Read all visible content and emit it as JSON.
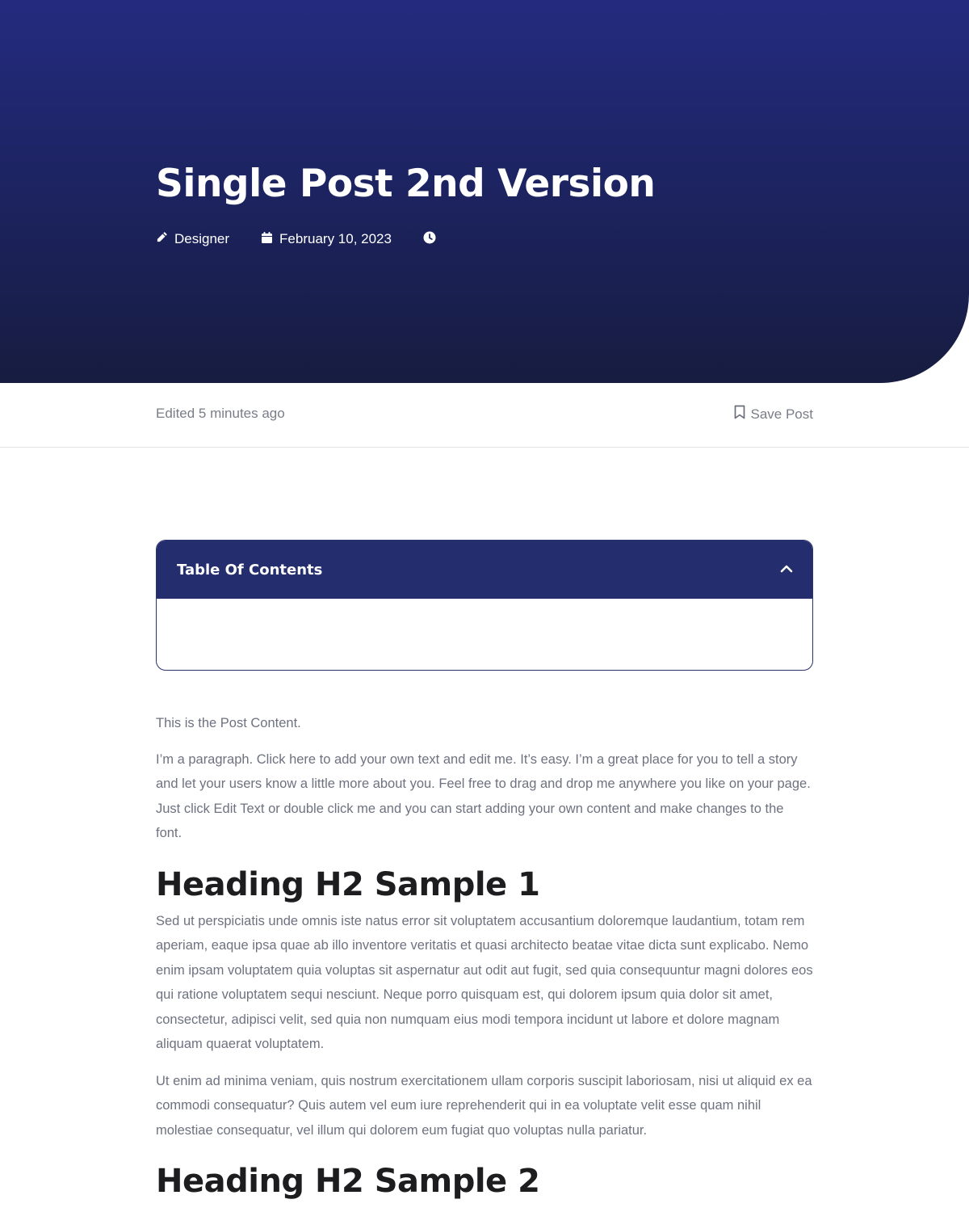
{
  "hero": {
    "title": "Single Post 2nd Version",
    "meta": {
      "author": "Designer",
      "date": "February 10, 2023",
      "reading_time": ""
    }
  },
  "subbar": {
    "edited": "Edited 5 minutes ago",
    "save_label": "Save Post"
  },
  "toc": {
    "title": "Table Of Contents"
  },
  "content": {
    "intro": "This is the Post Content.",
    "paragraph1": "I’m a paragraph. Click here to add your own text and edit me. It’s easy. I’m a great place for you to tell a story and let your users know a little more about you. Feel free to drag and drop me anywhere you like on your page. Just click Edit Text or double click me and you can start adding your own content and make changes to the font.",
    "heading1": "Heading H2 Sample 1",
    "paragraph2": "Sed ut perspiciatis unde omnis iste natus error sit voluptatem accusantium doloremque laudantium, totam rem aperiam, eaque ipsa quae ab illo inventore veritatis et quasi architecto beatae vitae dicta sunt explicabo. Nemo enim ipsam voluptatem quia voluptas sit aspernatur aut odit aut fugit, sed quia consequuntur magni dolores eos qui ratione voluptatem sequi nesciunt. Neque porro quisquam est, qui dolorem ipsum quia dolor sit amet, consectetur, adipisci velit, sed quia non numquam eius modi tempora incidunt ut labore et dolore magnam aliquam quaerat voluptatem.",
    "paragraph3": "Ut enim ad minima veniam, quis nostrum exercitationem ullam corporis suscipit laboriosam, nisi ut aliquid ex ea commodi consequatur? Quis autem vel eum iure reprehenderit qui in ea voluptate velit esse quam nihil molestiae consequatur, vel illum qui dolorem eum fugiat quo voluptas nulla pariatur.",
    "heading2": "Heading H2 Sample 2"
  },
  "colors": {
    "hero_top": "#242b7f",
    "hero_bottom": "#171c40",
    "toc_header": "#242e6e",
    "heading_text": "#1d1d1f",
    "body_text": "#6e7280"
  },
  "icons": {
    "author": "pencil-icon",
    "date": "calendar-icon",
    "reading_time": "clock-icon",
    "save": "bookmark-icon",
    "toc_toggle": "chevron-up-icon"
  }
}
